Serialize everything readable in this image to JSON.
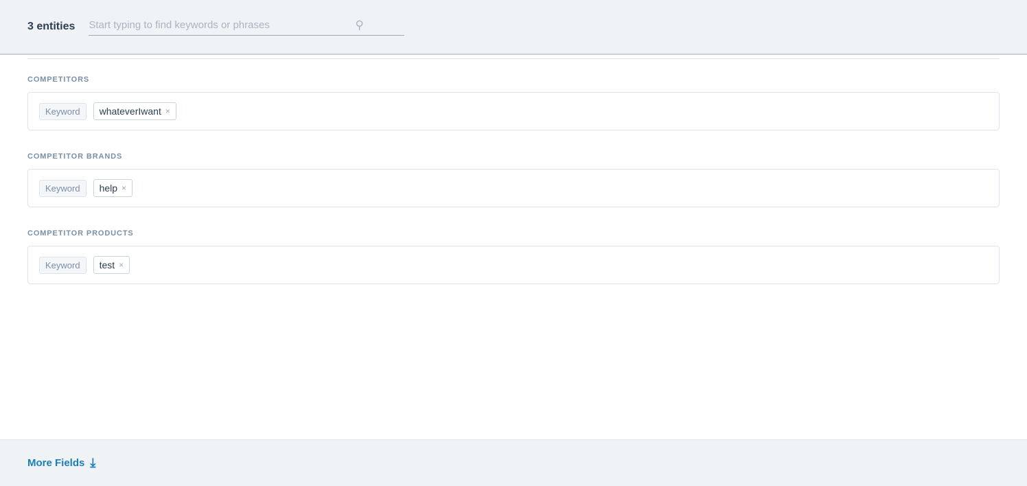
{
  "header": {
    "entities_count": "3 entities",
    "search_placeholder": "Start typing to find keywords or phrases"
  },
  "sections": [
    {
      "id": "competitors",
      "title": "COMPETITORS",
      "keyword_label": "Keyword",
      "tags": [
        {
          "text": "whateverIwant"
        }
      ]
    },
    {
      "id": "competitor_brands",
      "title": "COMPETITOR BRANDS",
      "keyword_label": "Keyword",
      "tags": [
        {
          "text": "help"
        }
      ]
    },
    {
      "id": "competitor_products",
      "title": "COMPETITOR PRODUCTS",
      "keyword_label": "Keyword",
      "tags": [
        {
          "text": "test"
        }
      ]
    }
  ],
  "footer": {
    "more_fields_label": "More Fields"
  },
  "icons": {
    "search": "🔍",
    "close": "×",
    "chevron_down": "⌄"
  }
}
